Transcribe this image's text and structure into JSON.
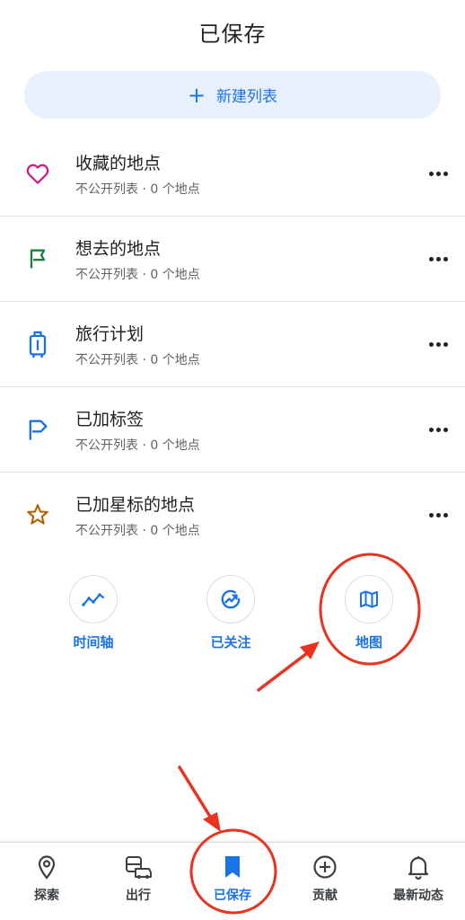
{
  "header": {
    "title": "已保存"
  },
  "new_list": {
    "label": "新建列表",
    "plus": "+"
  },
  "lists": [
    {
      "name": "收藏的地点",
      "meta": "不公开列表 · 0 个地点",
      "icon": "heart-icon",
      "color": "#d01884"
    },
    {
      "name": "想去的地点",
      "meta": "不公开列表 · 0 个地点",
      "icon": "flag-icon",
      "color": "#188038"
    },
    {
      "name": "旅行计划",
      "meta": "不公开列表 · 0 个地点",
      "icon": "suitcase-icon",
      "color": "#1a73e8"
    },
    {
      "name": "已加标签",
      "meta": "不公开列表 · 0 个地点",
      "icon": "label-flag-icon",
      "color": "#1a73e8"
    },
    {
      "name": "已加星标的地点",
      "meta": "不公开列表 · 0 个地点",
      "icon": "star-icon",
      "color": "#b06000"
    }
  ],
  "shortcuts": [
    {
      "label": "时间轴",
      "icon": "timeline-icon"
    },
    {
      "label": "已关注",
      "icon": "following-icon"
    },
    {
      "label": "地图",
      "icon": "map-icon"
    }
  ],
  "bottom_nav": [
    {
      "label": "探索",
      "icon": "location-pin-icon",
      "active": false
    },
    {
      "label": "出行",
      "icon": "commute-icon",
      "active": false
    },
    {
      "label": "已保存",
      "icon": "bookmark-icon",
      "active": true
    },
    {
      "label": "贡献",
      "icon": "add-circle-icon",
      "active": false
    },
    {
      "label": "最新动态",
      "icon": "bell-icon",
      "active": false
    }
  ],
  "colors": {
    "accent": "#1a73e8",
    "annotation_red": "#e8331f",
    "pill_bg": "#e8f0fe"
  }
}
